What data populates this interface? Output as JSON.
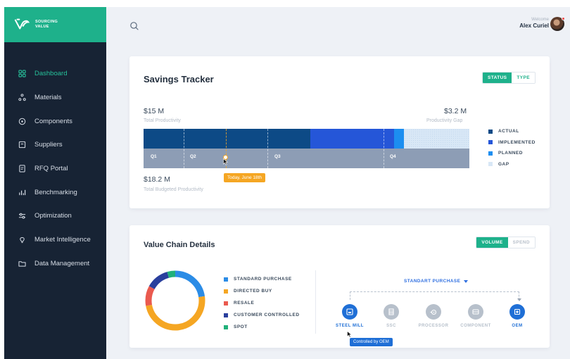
{
  "brand": {
    "line1": "SOURCING",
    "line2": "VALUE"
  },
  "sidebar": {
    "items": [
      {
        "label": "Dashboard",
        "icon": "grid-icon",
        "active": true
      },
      {
        "label": "Materials",
        "icon": "molecule-icon",
        "active": false
      },
      {
        "label": "Components",
        "icon": "target-icon",
        "active": false
      },
      {
        "label": "Suppliers",
        "icon": "box-icon",
        "active": false
      },
      {
        "label": "RFQ Portal",
        "icon": "document-icon",
        "active": false
      },
      {
        "label": "Benchmarking",
        "icon": "bars-icon",
        "active": false
      },
      {
        "label": "Optimization",
        "icon": "sliders-icon",
        "active": false
      },
      {
        "label": "Market Intelligence",
        "icon": "bulb-icon",
        "active": false
      },
      {
        "label": "Data Management",
        "icon": "folder-icon",
        "active": false
      }
    ]
  },
  "header": {
    "welcome": "Welcome",
    "user_name": "Alex Curiel"
  },
  "savings": {
    "title": "Savings Tracker",
    "toggle": {
      "status": "STATUS",
      "type": "TYPE"
    },
    "total_productivity_value": "$15 M",
    "total_productivity_label": "Total Productivity",
    "gap_value": "$3.2 M",
    "gap_label": "Productivity Gap",
    "budget_value": "$18.2 M",
    "budget_label": "Total Budgeted Productivity",
    "quarters": [
      "Q1",
      "Q2",
      "Q3",
      "Q4"
    ],
    "today_label": "Today, June 18th",
    "legend": [
      {
        "label": "ACTUAL",
        "color": "#0d4a86"
      },
      {
        "label": "IMPLEMENTED",
        "color": "#2556d8"
      },
      {
        "label": "PLANNED",
        "color": "#1c8ef0"
      },
      {
        "label": "GAP",
        "color": "#d8e7f6"
      }
    ]
  },
  "value_chain": {
    "title": "Value Chain Details",
    "toggle": {
      "volume": "VOLUME",
      "spend": "SPEND"
    },
    "legend": [
      {
        "label": "STANDARD PURCHASE",
        "color": "#2b8ce6"
      },
      {
        "label": "DIRECTED BUY",
        "color": "#f5a623"
      },
      {
        "label": "RESALE",
        "color": "#ea5a4f"
      },
      {
        "label": "CUSTOMER CONTROLLED",
        "color": "#2a3f9d"
      },
      {
        "label": "SPOT",
        "color": "#21b07a"
      }
    ],
    "dropdown": "STANDART PURCHASE",
    "nodes": [
      {
        "label": "STEEL MILL",
        "active": true,
        "icon": "factory-icon"
      },
      {
        "label": "SSC",
        "active": false,
        "icon": "warehouse-icon"
      },
      {
        "label": "PROCESSOR",
        "active": false,
        "icon": "saw-icon"
      },
      {
        "label": "COMPONENT",
        "active": false,
        "icon": "component-icon"
      },
      {
        "label": "OEM",
        "active": true,
        "icon": "oem-icon"
      }
    ],
    "tooltip": "Controlled by OEM"
  }
}
